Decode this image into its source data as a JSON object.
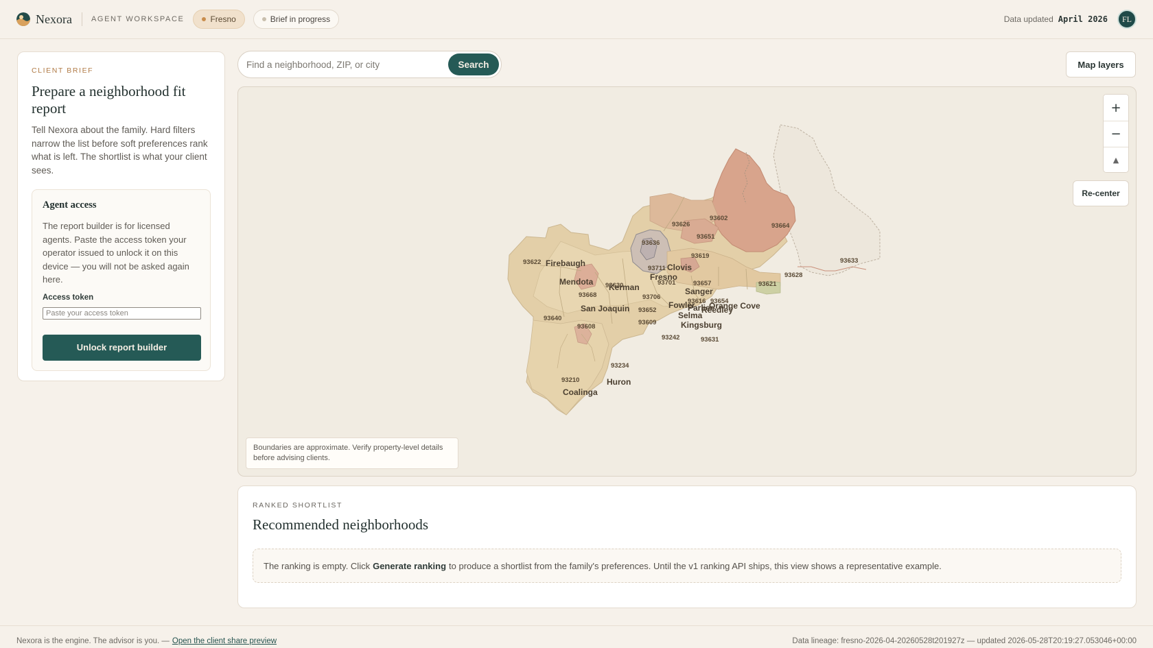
{
  "header": {
    "brand": "Nexora",
    "workspace": "AGENT WORKSPACE",
    "city_pill": "Fresno",
    "status_pill": "Brief in progress",
    "updated_label": "Data updated",
    "updated_value": "April 2026",
    "avatar_initials": "FL"
  },
  "brief": {
    "eyebrow": "CLIENT BRIEF",
    "title": "Prepare a neighborhood fit report",
    "description": "Tell Nexora about the family. Hard filters narrow the list before soft preferences rank what is left. The shortlist is what your client sees.",
    "access": {
      "title": "Agent access",
      "description": "The report builder is for licensed agents. Paste the access token your operator issued to unlock it on this device — you will not be asked again here.",
      "token_label": "Access token",
      "token_placeholder": "Paste your access token",
      "token_value": "",
      "unlock_label": "Unlock report builder"
    }
  },
  "search": {
    "placeholder": "Find a neighborhood, ZIP, or city",
    "value": "",
    "button_label": "Search"
  },
  "map": {
    "layers_label": "Map layers",
    "zoom_in": "+",
    "zoom_out": "−",
    "north": "▲",
    "recenter_label": "Re-center",
    "note": "Boundaries are approximate. Verify property-level details before advising clients.",
    "zip_labels": [
      "93626",
      "93602",
      "93664",
      "93651",
      "93636",
      "93619",
      "93633",
      "93622",
      "93628",
      "93621",
      "93657",
      "93668",
      "93706",
      "93616",
      "93654",
      "93652",
      "93609",
      "93640",
      "93608",
      "93242",
      "93631",
      "93234",
      "93210",
      "93630",
      "93711",
      "93701"
    ],
    "city_labels": [
      "Firebaugh",
      "Clovis",
      "Fresno",
      "Mendota",
      "Kerman",
      "Sanger",
      "San Joaquin",
      "Fowler",
      "Parlier",
      "Orange Cove",
      "Reedley",
      "Selma",
      "Kingsburg",
      "Huron",
      "Coalinga"
    ]
  },
  "shortlist": {
    "eyebrow": "RANKED SHORTLIST",
    "title": "Recommended neighborhoods",
    "empty_pre": "The ranking is empty. Click",
    "empty_action": "Generate ranking",
    "empty_post": "to produce a shortlist from the family's preferences. Until the v1 ranking API ships, this view shows a representative example."
  },
  "footer": {
    "tagline": "Nexora is the engine. The advisor is you. —",
    "share_link": "Open the client share preview",
    "lineage": "Data lineage: fresno-2026-04-20260528t201927z — updated 2026-05-28T20:19:27.053046+00:00"
  },
  "colors": {
    "accent": "#255a56",
    "page_bg": "#f6f1ea",
    "city_pill_bg": "#f1e1cc",
    "eyebrow": "#b07a45",
    "map_high": "#d8a48c",
    "map_mid": "#e1c6a2",
    "map_low": "#eadcbd"
  }
}
